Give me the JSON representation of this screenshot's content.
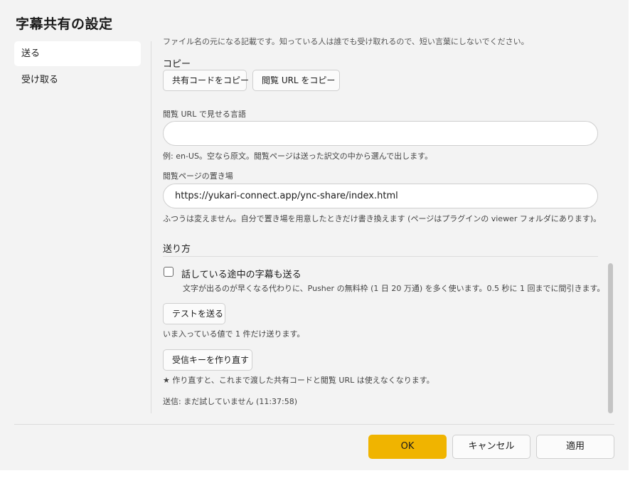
{
  "window": {
    "title": "字幕共有の設定"
  },
  "nav": {
    "items": [
      {
        "label": "送る",
        "selected": true
      },
      {
        "label": "受け取る",
        "selected": false
      }
    ]
  },
  "content": {
    "clipped_text": "ファイル名の元になる記載です。知っている人は誰でも受け取れるので、短い言葉にしないでください。",
    "copy": {
      "label": "コピー",
      "copy_share_code": "共有コードをコピー",
      "copy_view_url": "閲覧 URL をコピー"
    },
    "view_lang": {
      "label": "閲覧 URL で見せる言語",
      "value": "",
      "hint": "例: en-US。空なら原文。閲覧ページは送った訳文の中から選んで出します。"
    },
    "viewer_location": {
      "label": "閲覧ページの置き場",
      "value": "https://yukari-connect.app/ync-share/index.html",
      "hint": "ふつうは変えません。自分で置き場を用意したときだけ書き換えます (ページはプラグインの viewer フォルダにあります)。"
    },
    "send_method": {
      "label": "送り方",
      "checkbox_label": "話している途中の字幕も送る",
      "checkbox_checked": false,
      "checkbox_hint": "文字が出るのが早くなる代わりに、Pusher の無料枠 (1 日 20 万通) を多く使います。0.5 秒に 1 回までに間引きます。"
    },
    "test": {
      "button": "テストを送る",
      "hint": "いま入っている値で 1 件だけ送ります。"
    },
    "regen": {
      "button": "受信キーを作り直す",
      "hint": "★ 作り直すと、これまで渡した共有コードと閲覧 URL は使えなくなります。"
    },
    "status": "送信: まだ試していません (11:37:58)"
  },
  "footer": {
    "ok": "OK",
    "cancel": "キャンセル",
    "apply": "適用"
  },
  "colors": {
    "accent": "#f0b400",
    "background": "#f3f3f3"
  }
}
